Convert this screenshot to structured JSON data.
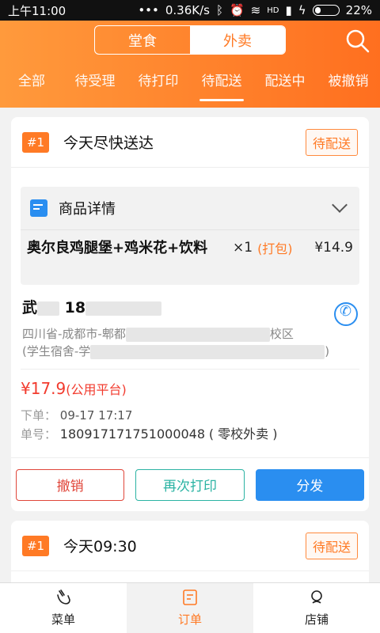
{
  "statusbar": {
    "time": "上午11:00",
    "network_speed": "0.36K/s",
    "signal": "HD",
    "battery": "22%"
  },
  "header": {
    "segments": [
      "堂食",
      "外卖"
    ],
    "active_segment": "外卖",
    "tabs": [
      "全部",
      "待受理",
      "待打印",
      "待配送",
      "配送中",
      "被撤销"
    ],
    "active_tab": "待配送"
  },
  "orders": [
    {
      "index": "#1",
      "title": "今天尽快送达",
      "status": "待配送",
      "goods_title": "商品详情",
      "goods": {
        "name": "奥尔良鸡腿堡+鸡米花+饮料",
        "qty": "×1",
        "pack": "(打包)",
        "price": "¥14.9"
      },
      "customer": {
        "name": "武",
        "phone": "18",
        "addr1_start": "四川省-成都市-郫都",
        "addr1_end": "校区",
        "addr2_start": "(学生宿舍-学",
        "addr2_end": ")"
      },
      "total": "¥17.9",
      "platform": "(公用平台)",
      "order_time_label": "下单：",
      "order_time": "09-17 17:17",
      "order_no_label": "单号：",
      "order_no": "180917171751000048",
      "source": "( 零校外卖 )",
      "actions": {
        "cancel": "撤销",
        "reprint": "再次打印",
        "dispatch": "分发"
      }
    },
    {
      "index": "#1",
      "title": "今天09:30",
      "status": "待配送"
    }
  ],
  "bottomnav": {
    "items": [
      "菜单",
      "订单",
      "店铺"
    ],
    "active": "订单"
  }
}
